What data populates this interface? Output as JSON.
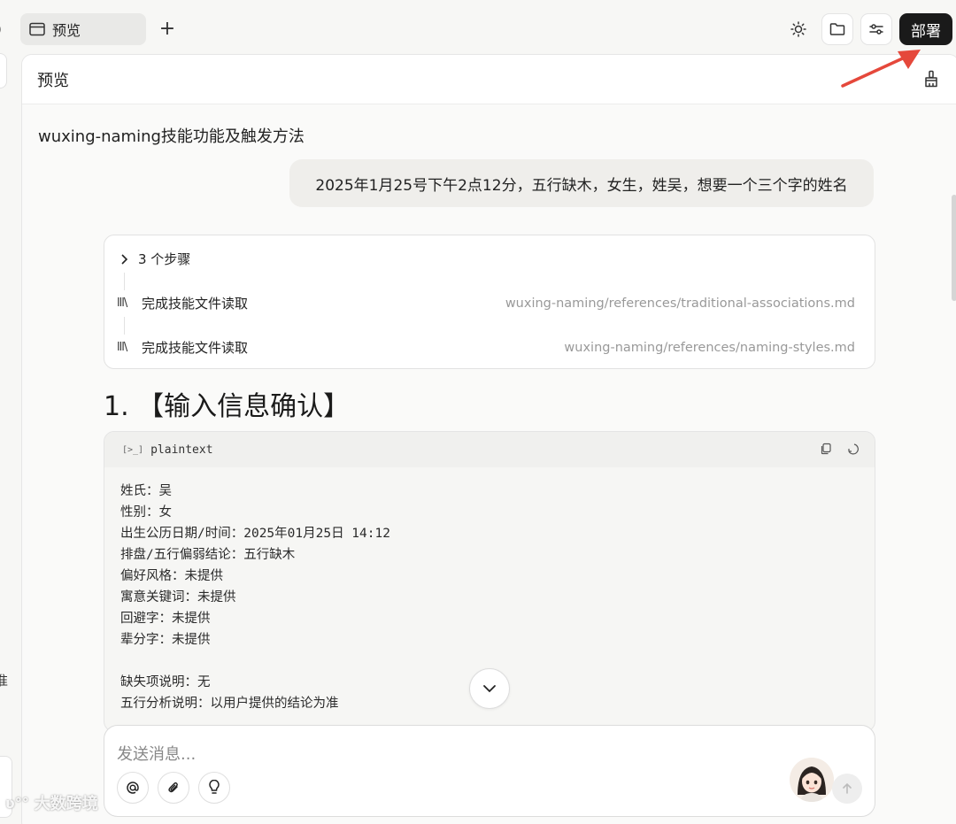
{
  "tab": {
    "label": "预览",
    "add": "+"
  },
  "toolbar": {
    "deploy_label": "部署"
  },
  "panel": {
    "title": "预览"
  },
  "conversation": {
    "title": "wuxing-naming技能功能及触发方法",
    "user_message": "2025年1月25号下午2点12分，五行缺木，女生，姓吴，想要一个三个字的姓名"
  },
  "steps": {
    "summary": "3 个步骤",
    "items": [
      {
        "label": "完成技能文件读取",
        "path": "wuxing-naming/references/traditional-associations.md"
      },
      {
        "label": "完成技能文件读取",
        "path": "wuxing-naming/references/naming-styles.md"
      }
    ]
  },
  "heading": "1. 【输入信息确认】",
  "code": {
    "lang": "plaintext",
    "lines": [
      "姓氏：吴",
      "性别：女",
      "出生公历日期/时间：2025年01月25日 14:12",
      "排盘/五行偏弱结论：五行缺木",
      "偏好风格：未提供",
      "寓意关键词：未提供",
      "回避字：未提供",
      "辈分字：未提供",
      "",
      "缺失项说明：无",
      "五行分析说明：以用户提供的结论为准"
    ]
  },
  "composer": {
    "placeholder": "发送消息..."
  },
  "watermark": "大数跨境",
  "colors": {
    "deploy_bg": "#1a1a1a",
    "arrow": "#e5483b"
  }
}
